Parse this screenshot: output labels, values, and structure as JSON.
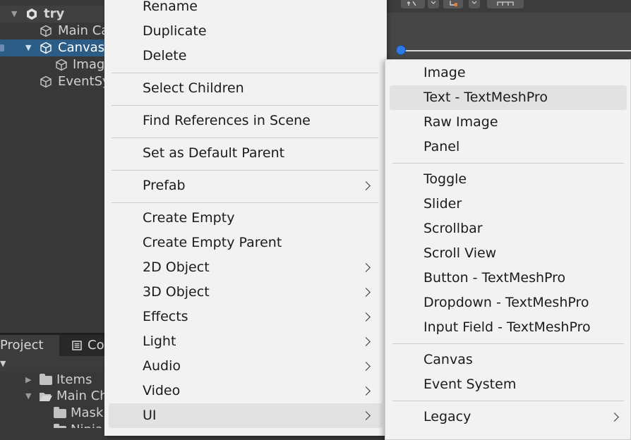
{
  "hierarchy": {
    "scene_name": "try",
    "items": [
      {
        "label": "Main Ca"
      },
      {
        "label": "Canvas"
      },
      {
        "label": "Imag"
      },
      {
        "label": "EventSy"
      }
    ]
  },
  "project": {
    "tabs": [
      {
        "label": "Project"
      },
      {
        "label": "Co"
      }
    ],
    "tree": [
      {
        "label": "Items"
      },
      {
        "label": "Main Ch"
      },
      {
        "label": "Mask"
      },
      {
        "label": "Ninja"
      }
    ]
  },
  "context_menu": {
    "items": [
      {
        "label": "Rename"
      },
      {
        "label": "Duplicate"
      },
      {
        "label": "Delete"
      },
      {
        "label": "Select Children"
      },
      {
        "label": "Find References in Scene"
      },
      {
        "label": "Set as Default Parent"
      },
      {
        "label": "Prefab"
      },
      {
        "label": "Create Empty"
      },
      {
        "label": "Create Empty Parent"
      },
      {
        "label": "2D Object"
      },
      {
        "label": "3D Object"
      },
      {
        "label": "Effects"
      },
      {
        "label": "Light"
      },
      {
        "label": "Audio"
      },
      {
        "label": "Video"
      },
      {
        "label": "UI"
      }
    ]
  },
  "ui_submenu": {
    "items": [
      {
        "label": "Image"
      },
      {
        "label": "Text - TextMeshPro"
      },
      {
        "label": "Raw Image"
      },
      {
        "label": "Panel"
      },
      {
        "label": "Toggle"
      },
      {
        "label": "Slider"
      },
      {
        "label": "Scrollbar"
      },
      {
        "label": "Scroll View"
      },
      {
        "label": "Button - TextMeshPro"
      },
      {
        "label": "Dropdown - TextMeshPro"
      },
      {
        "label": "Input Field - TextMeshPro"
      },
      {
        "label": "Canvas"
      },
      {
        "label": "Event System"
      },
      {
        "label": "Legacy"
      }
    ]
  },
  "colors": {
    "selection": "#2c5d87",
    "menu_background": "#f2f2f2",
    "menu_highlight": "#e2e2e2",
    "editor_background": "#383838"
  }
}
